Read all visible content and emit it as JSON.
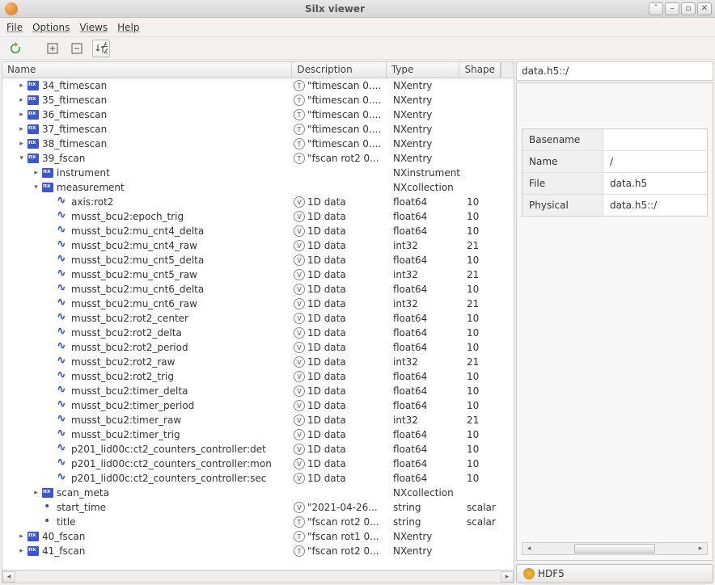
{
  "window": {
    "title": "Silx viewer"
  },
  "menu": {
    "file": "File",
    "options": "Options",
    "views": "Views",
    "help": "Help"
  },
  "columns": {
    "name": "Name",
    "desc": "Description",
    "type": "Type",
    "shape": "Shape"
  },
  "right": {
    "path": "data.h5::/",
    "rows": [
      {
        "key": "Basename",
        "val": ""
      },
      {
        "key": "Name",
        "val": "/"
      },
      {
        "key": "File",
        "val": "data.h5"
      },
      {
        "key": "Physical",
        "val": "data.h5::/"
      }
    ],
    "hdf5": "HDF5"
  },
  "tree": [
    {
      "indent": 1,
      "exp": "r",
      "icon": "nx",
      "name": "34_ftimescan",
      "badge": "T",
      "desc": "\"ftimescan 0....",
      "type": "NXentry",
      "shape": ""
    },
    {
      "indent": 1,
      "exp": "r",
      "icon": "nx",
      "name": "35_ftimescan",
      "badge": "T",
      "desc": "\"ftimescan 0....",
      "type": "NXentry",
      "shape": ""
    },
    {
      "indent": 1,
      "exp": "r",
      "icon": "nx",
      "name": "36_ftimescan",
      "badge": "T",
      "desc": "\"ftimescan 0....",
      "type": "NXentry",
      "shape": ""
    },
    {
      "indent": 1,
      "exp": "r",
      "icon": "nx",
      "name": "37_ftimescan",
      "badge": "T",
      "desc": "\"ftimescan 0....",
      "type": "NXentry",
      "shape": ""
    },
    {
      "indent": 1,
      "exp": "r",
      "icon": "nx",
      "name": "38_ftimescan",
      "badge": "T",
      "desc": "\"ftimescan 0....",
      "type": "NXentry",
      "shape": ""
    },
    {
      "indent": 1,
      "exp": "d",
      "icon": "nx",
      "name": "39_fscan",
      "badge": "T",
      "desc": "\"fscan rot2 0...",
      "type": "NXentry",
      "shape": ""
    },
    {
      "indent": 2,
      "exp": "r",
      "icon": "nx",
      "name": "instrument",
      "badge": "",
      "desc": "",
      "type": "NXinstrument",
      "shape": ""
    },
    {
      "indent": 2,
      "exp": "d",
      "icon": "nx",
      "name": "measurement",
      "badge": "",
      "desc": "",
      "type": "NXcollection",
      "shape": ""
    },
    {
      "indent": 3,
      "exp": "",
      "icon": "wave",
      "name": "axis:rot2",
      "badge": "V",
      "desc": "1D data",
      "type": "float64",
      "shape": "10"
    },
    {
      "indent": 3,
      "exp": "",
      "icon": "wave",
      "name": "musst_bcu2:epoch_trig",
      "badge": "V",
      "desc": "1D data",
      "type": "float64",
      "shape": "10"
    },
    {
      "indent": 3,
      "exp": "",
      "icon": "wave",
      "name": "musst_bcu2:mu_cnt4_delta",
      "badge": "V",
      "desc": "1D data",
      "type": "float64",
      "shape": "10"
    },
    {
      "indent": 3,
      "exp": "",
      "icon": "wave",
      "name": "musst_bcu2:mu_cnt4_raw",
      "badge": "V",
      "desc": "1D data",
      "type": "int32",
      "shape": "21"
    },
    {
      "indent": 3,
      "exp": "",
      "icon": "wave",
      "name": "musst_bcu2:mu_cnt5_delta",
      "badge": "V",
      "desc": "1D data",
      "type": "float64",
      "shape": "10"
    },
    {
      "indent": 3,
      "exp": "",
      "icon": "wave",
      "name": "musst_bcu2:mu_cnt5_raw",
      "badge": "V",
      "desc": "1D data",
      "type": "int32",
      "shape": "21"
    },
    {
      "indent": 3,
      "exp": "",
      "icon": "wave",
      "name": "musst_bcu2:mu_cnt6_delta",
      "badge": "V",
      "desc": "1D data",
      "type": "float64",
      "shape": "10"
    },
    {
      "indent": 3,
      "exp": "",
      "icon": "wave",
      "name": "musst_bcu2:mu_cnt6_raw",
      "badge": "V",
      "desc": "1D data",
      "type": "int32",
      "shape": "21"
    },
    {
      "indent": 3,
      "exp": "",
      "icon": "wave",
      "name": "musst_bcu2:rot2_center",
      "badge": "V",
      "desc": "1D data",
      "type": "float64",
      "shape": "10"
    },
    {
      "indent": 3,
      "exp": "",
      "icon": "wave",
      "name": "musst_bcu2:rot2_delta",
      "badge": "V",
      "desc": "1D data",
      "type": "float64",
      "shape": "10"
    },
    {
      "indent": 3,
      "exp": "",
      "icon": "wave",
      "name": "musst_bcu2:rot2_period",
      "badge": "V",
      "desc": "1D data",
      "type": "float64",
      "shape": "10"
    },
    {
      "indent": 3,
      "exp": "",
      "icon": "wave",
      "name": "musst_bcu2:rot2_raw",
      "badge": "V",
      "desc": "1D data",
      "type": "int32",
      "shape": "21"
    },
    {
      "indent": 3,
      "exp": "",
      "icon": "wave",
      "name": "musst_bcu2:rot2_trig",
      "badge": "V",
      "desc": "1D data",
      "type": "float64",
      "shape": "10"
    },
    {
      "indent": 3,
      "exp": "",
      "icon": "wave",
      "name": "musst_bcu2:timer_delta",
      "badge": "V",
      "desc": "1D data",
      "type": "float64",
      "shape": "10"
    },
    {
      "indent": 3,
      "exp": "",
      "icon": "wave",
      "name": "musst_bcu2:timer_period",
      "badge": "V",
      "desc": "1D data",
      "type": "float64",
      "shape": "10"
    },
    {
      "indent": 3,
      "exp": "",
      "icon": "wave",
      "name": "musst_bcu2:timer_raw",
      "badge": "V",
      "desc": "1D data",
      "type": "int32",
      "shape": "21"
    },
    {
      "indent": 3,
      "exp": "",
      "icon": "wave",
      "name": "musst_bcu2:timer_trig",
      "badge": "V",
      "desc": "1D data",
      "type": "float64",
      "shape": "10"
    },
    {
      "indent": 3,
      "exp": "",
      "icon": "wave",
      "name": "p201_lid00c:ct2_counters_controller:det",
      "badge": "V",
      "desc": "1D data",
      "type": "float64",
      "shape": "10"
    },
    {
      "indent": 3,
      "exp": "",
      "icon": "wave",
      "name": "p201_lid00c:ct2_counters_controller:mon",
      "badge": "V",
      "desc": "1D data",
      "type": "float64",
      "shape": "10"
    },
    {
      "indent": 3,
      "exp": "",
      "icon": "wave",
      "name": "p201_lid00c:ct2_counters_controller:sec",
      "badge": "V",
      "desc": "1D data",
      "type": "float64",
      "shape": "10"
    },
    {
      "indent": 2,
      "exp": "r",
      "icon": "nx",
      "name": "scan_meta",
      "badge": "",
      "desc": "",
      "type": "NXcollection",
      "shape": ""
    },
    {
      "indent": 2,
      "exp": "",
      "icon": "dot",
      "name": "start_time",
      "badge": "V",
      "desc": "\"2021-04-26...",
      "type": "string",
      "shape": "scalar"
    },
    {
      "indent": 2,
      "exp": "",
      "icon": "dot",
      "name": "title",
      "badge": "T",
      "desc": "\"fscan rot2 0...",
      "type": "string",
      "shape": "scalar"
    },
    {
      "indent": 1,
      "exp": "r",
      "icon": "nx",
      "name": "40_fscan",
      "badge": "T",
      "desc": "\"fscan rot1 0...",
      "type": "NXentry",
      "shape": ""
    },
    {
      "indent": 1,
      "exp": "r",
      "icon": "nx",
      "name": "41_fscan",
      "badge": "T",
      "desc": "\"fscan rot2 0...",
      "type": "NXentry",
      "shape": ""
    }
  ]
}
